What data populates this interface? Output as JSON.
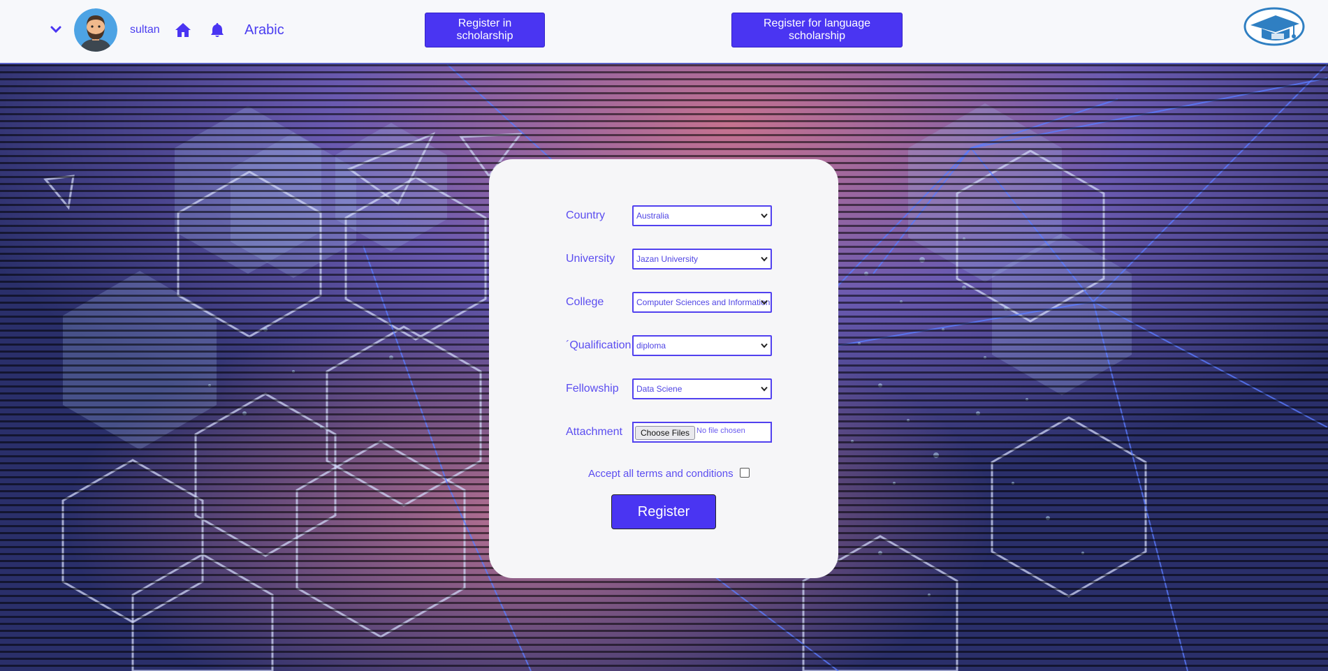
{
  "header": {
    "username": "sultan",
    "language_link": "Arabic",
    "register_scholarship_label": "Register in scholarship",
    "register_language_scholarship_label": "Register for language scholarship"
  },
  "form": {
    "fields": [
      {
        "label": "Country",
        "value": "Australia"
      },
      {
        "label": "University",
        "value": "Jazan University"
      },
      {
        "label": "College",
        "value": "Computer Sciences and Information"
      },
      {
        "label": "´Qualification",
        "value": "diploma"
      },
      {
        "label": "Fellowship",
        "value": "Data Sciene"
      }
    ],
    "attachment": {
      "label": "Attachment",
      "button_label": "Choose Files",
      "status": "No file chosen"
    },
    "terms_label": "Accept all terms and conditions",
    "terms_checked": false,
    "submit_label": "Register"
  },
  "colors": {
    "accent": "#4a35f2",
    "label_text": "#5b4df0",
    "nav_background": "#f7f8fb",
    "card_background": "#f6f6f8"
  },
  "icons": [
    "chevron-down-icon",
    "avatar",
    "home-icon",
    "bell-icon",
    "graduation-cap-logo",
    "select-arrow-icon"
  ]
}
